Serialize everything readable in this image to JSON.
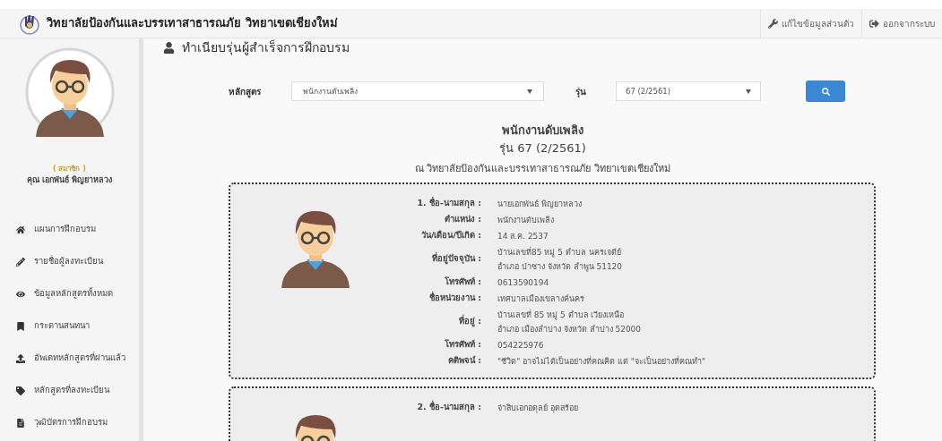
{
  "header": {
    "title": "วิทยาลัยป้องกันและบรรเทาสาธารณภัย วิทยาเขตเชียงใหม่",
    "actions": [
      {
        "kind": "edit",
        "label": "แก้ไขข้อมูลส่วนตัว"
      },
      {
        "kind": "logout",
        "label": "ออกจากระบบ"
      }
    ]
  },
  "sidebar": {
    "role": "( สมาชิก )",
    "name": "คุณ เอกพันธ์ พิญยาหลวง",
    "items": [
      {
        "kind": "home",
        "label": "แผนการฝึกอบรม"
      },
      {
        "kind": "pencil",
        "label": "รายชื่อผู้ลงทะเบียน"
      },
      {
        "kind": "eye",
        "label": "ข้อมูลหลักสูตรทั้งหมด"
      },
      {
        "kind": "bookmark",
        "label": "กระดานสนทนา"
      },
      {
        "kind": "upload",
        "label": "อัพเดทหลักสูตรที่ผ่านแล้ว"
      },
      {
        "kind": "tag",
        "label": "หลักสูตรที่ลงทะเบียน"
      },
      {
        "kind": "file",
        "label": "วุฒิบัตรการฝึกอบรม"
      }
    ]
  },
  "page_title": "ทำเนียบรุ่นผู้สำเร็จการฝึกอบรม",
  "filters": {
    "course_label": "หลักสูตร",
    "course_value": "พนักงานดับเพลิง",
    "batch_label": "รุ่น",
    "batch_value": "67 (2/2561)"
  },
  "heading": {
    "course": "พนักงานดับเพลิง",
    "batch": "รุ่น 67 (2/2561)",
    "location": "ณ วิทยาลัยป้องกันและบรรเทาสาธารณภัย วิทยาเขตเชียงใหม่"
  },
  "graduates": [
    {
      "fields": [
        {
          "label": "1. ชื่อ-นามสกุล :",
          "lines": [
            "นายเอกพันธ์ พิญยาหลวง"
          ]
        },
        {
          "label": "ตำแหน่ง :",
          "lines": [
            "พนักงานดับเพลิง"
          ]
        },
        {
          "label": "วัน/เดือน/ปีเกิด :",
          "lines": [
            "14 ส.ค. 2537"
          ]
        },
        {
          "label": "ที่อยู่ปัจจุบัน :",
          "lines": [
            "บ้านเลขที่85 หมู่ 5 ตำบล นครเจดีย์",
            "อำเภอ ป่าซาง จังหวัด ลำพูน 51120"
          ]
        },
        {
          "label": "โทรศัพท์ :",
          "lines": [
            "0613590194"
          ]
        },
        {
          "label": "ชื่อหน่วยงาน :",
          "lines": [
            "เทศบาลเมืองเขลางค์นคร"
          ]
        },
        {
          "label": "ที่อยู่ :",
          "lines": [
            "บ้านเลขที่ 85 หมู่ 5 ตำบล เวียงเหนือ",
            "อำเภอ เมืองลำปาง จังหวัด ลำปาง 52000"
          ]
        },
        {
          "label": "โทรศัพท์ :",
          "lines": [
            "054225976"
          ]
        },
        {
          "label": "คติพจน์ :",
          "lines": [
            "\"ชีวิต\" อาจไม่ได้เป็นอย่างที่คณคิด แต่ \"จะเป็นอย่างที่คณทำ\""
          ]
        }
      ]
    },
    {
      "fields": [
        {
          "label": "2. ชื่อ-นามสกุล :",
          "lines": [
            "จ่าสิบเอกอดุลย์ อุดสร้อย"
          ]
        }
      ]
    }
  ]
}
